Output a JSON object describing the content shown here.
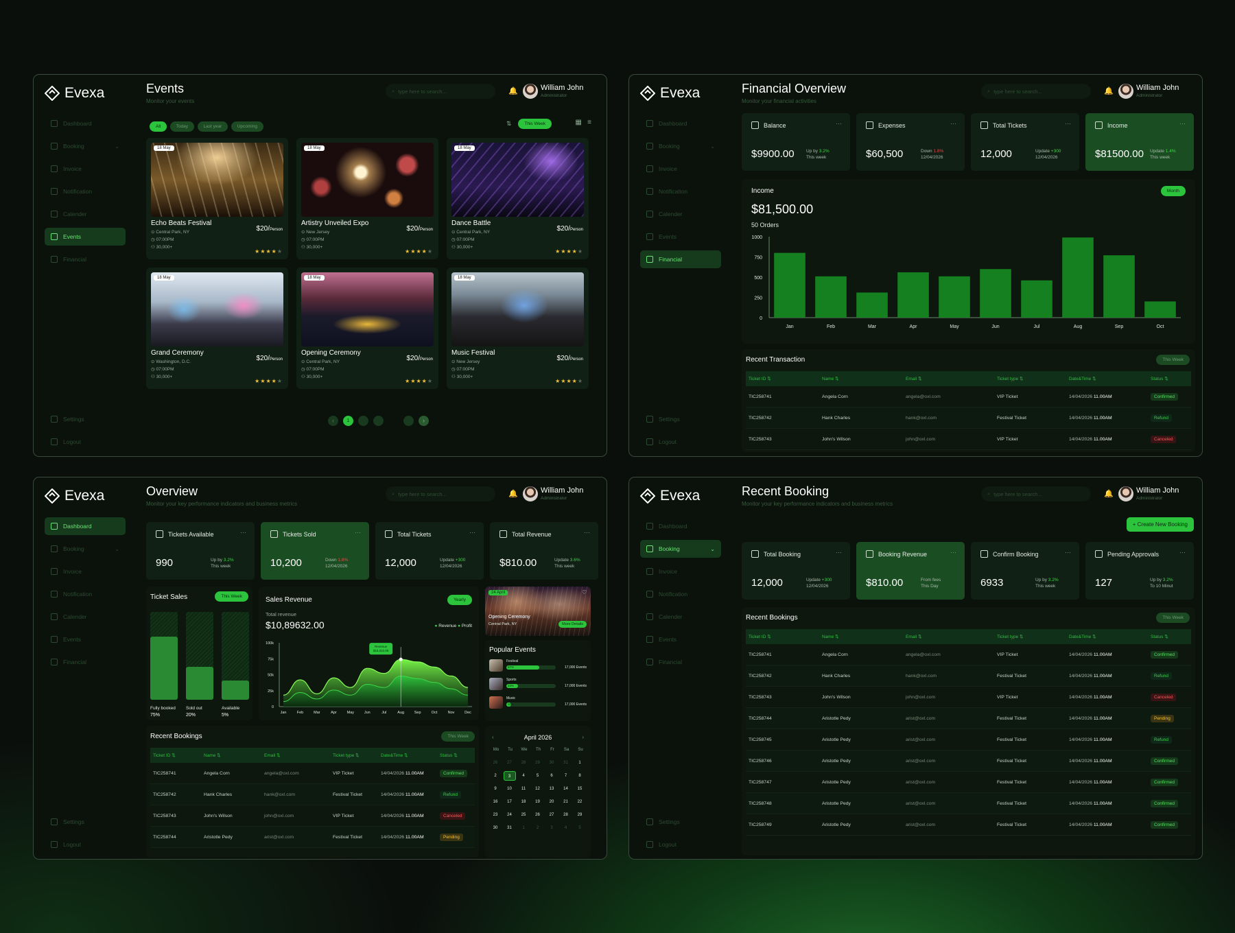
{
  "brand": "Evexa",
  "user": {
    "name": "William John",
    "role": "Administrator"
  },
  "search_placeholder": "type here to search...",
  "nav": {
    "dashboard": "Dashboard",
    "booking": "Booking",
    "invoice": "Invoice",
    "notification": "Notification",
    "calender": "Calender",
    "events": "Events",
    "financial": "Financial",
    "settings": "Settings",
    "logout": "Logout"
  },
  "events_page": {
    "title": "Events",
    "subtitle": "Monitor your events",
    "filters": [
      "All",
      "Today",
      "Last year",
      "Upcoming"
    ],
    "period": "This Week",
    "events": [
      {
        "date": "18 May",
        "name": "Echo Beats Festival",
        "location": "Central Park, NY",
        "time": "07:00PM",
        "count": "30,000+",
        "price": "$20/",
        "unit": "Person",
        "rating": 4
      },
      {
        "date": "18 May",
        "name": "Artistry Unveiled Expo",
        "location": "New Jersey",
        "time": "07:00PM",
        "count": "30,000+",
        "price": "$20/",
        "unit": "Person",
        "rating": 4
      },
      {
        "date": "18 May",
        "name": "Dance Battle",
        "location": "Central Park, NY",
        "time": "07:00PM",
        "count": "30,000+",
        "price": "$20/",
        "unit": "Person",
        "rating": 4
      },
      {
        "date": "18 May",
        "name": "Grand Ceremony",
        "location": "Washington, D.C.",
        "time": "07:00PM",
        "count": "30,000+",
        "price": "$20/",
        "unit": "Person",
        "rating": 4
      },
      {
        "date": "18 May",
        "name": "Opening Ceremony",
        "location": "Central Park, NY",
        "time": "07:00PM",
        "count": "30,000+",
        "price": "$20/",
        "unit": "Person",
        "rating": 4
      },
      {
        "date": "18 May",
        "name": "Music Festival",
        "location": "New Jersey",
        "time": "07:00PM",
        "count": "30,000+",
        "price": "$20/",
        "unit": "Person",
        "rating": 4
      }
    ],
    "pagination": {
      "current": 1,
      "pages": [
        "1",
        "2",
        "3",
        "...",
        "9"
      ]
    }
  },
  "financial_page": {
    "title": "Financial Overview",
    "subtitle": "Monitor your financial activities",
    "stats": [
      {
        "label": "Balance",
        "value": "$9900.00",
        "delta_label": "Up by",
        "delta": "3.2%",
        "note": "This week",
        "trend": "up"
      },
      {
        "label": "Expenses",
        "value": "$60,500",
        "delta_label": "Down",
        "delta": "1.8%",
        "note": "12/04/2026",
        "trend": "down"
      },
      {
        "label": "Total Tickets",
        "value": "12,000",
        "delta_label": "Update",
        "delta": "+300",
        "note": "12/04/2026",
        "trend": "up"
      },
      {
        "label": "Income",
        "value": "$81500.00",
        "delta_label": "Update",
        "delta": "1.4%",
        "note": "This week",
        "trend": "up"
      }
    ],
    "income": {
      "label": "Income",
      "value": "$81,500.00",
      "orders": "50 Orders",
      "period": "Month"
    },
    "recent_title": "Recent Transaction",
    "recent_period": "This Week"
  },
  "table_headers": [
    "Ticket ID",
    "Name",
    "Email",
    "Ticket type",
    "Date&Time",
    "Status"
  ],
  "transactions": [
    {
      "id": "TIC258741",
      "name": "Angela Corn",
      "email": "angela@oxl.com",
      "type": "VIP Ticket",
      "date": "14/04/2026",
      "time": "11.00AM",
      "status": "Confirmed"
    },
    {
      "id": "TIC258742",
      "name": "Hank Charles",
      "email": "hank@oxl.com",
      "type": "Festival Ticket",
      "date": "14/04/2026",
      "time": "11.00AM",
      "status": "Refund"
    },
    {
      "id": "TIC258743",
      "name": "John's Wilson",
      "email": "john@oxl.com",
      "type": "VIP Ticket",
      "date": "14/04/2026",
      "time": "11.00AM",
      "status": "Canceled"
    },
    {
      "id": "TIC258744",
      "name": "Aristotle Pedy",
      "email": "arist@oxl.com",
      "type": "Festival Ticket",
      "date": "14/04/2026",
      "time": "11.00AM",
      "status": "Pending"
    },
    {
      "id": "TIC258745",
      "name": "Aristotle Pedy",
      "email": "arist@oxl.com",
      "type": "Festival Ticket",
      "date": "14/04/2026",
      "time": "11.00AM",
      "status": "Refund"
    },
    {
      "id": "TIC258746",
      "name": "Aristotle Pedy",
      "email": "arist@oxl.com",
      "type": "Festival Ticket",
      "date": "14/04/2026",
      "time": "11.00AM",
      "status": "Confirmed"
    },
    {
      "id": "TIC258747",
      "name": "Aristotle Pedy",
      "email": "arist@oxl.com",
      "type": "Festival Ticket",
      "date": "14/04/2026",
      "time": "11.00AM",
      "status": "Confirmed"
    },
    {
      "id": "TIC258748",
      "name": "Aristotle Pedy",
      "email": "arist@oxl.com",
      "type": "Festival Ticket",
      "date": "14/04/2026",
      "time": "11.00AM",
      "status": "Confirmed"
    },
    {
      "id": "TIC258749",
      "name": "Aristotle Pedy",
      "email": "arist@oxl.com",
      "type": "Festival Ticket",
      "date": "14/04/2026",
      "time": "11.00AM",
      "status": "Confirmed"
    }
  ],
  "overview_page": {
    "title": "Overview",
    "subtitle": "Monitor your key performance indicators and business metrics",
    "stats": [
      {
        "label": "Tickets Available",
        "value": "990",
        "delta_label": "Up by",
        "delta": "3.2%",
        "note": "This week",
        "trend": "up"
      },
      {
        "label": "Tickets Sold",
        "value": "10,200",
        "delta_label": "Down",
        "delta": "1.8%",
        "note": "12/04/2026",
        "trend": "down"
      },
      {
        "label": "Total Tickets",
        "value": "12,000",
        "delta_label": "Update",
        "delta": "+300",
        "note": "12/04/2026",
        "trend": "up"
      },
      {
        "label": "Total Revenue",
        "value": "$810.00",
        "delta_label": "Update",
        "delta": "3.6%",
        "note": "This week",
        "trend": "up"
      }
    ],
    "ticket_sales": {
      "title": "Ticket Sales",
      "period": "This Week",
      "bars": [
        {
          "label": "Fully booked",
          "pct": "75%",
          "value": 75
        },
        {
          "label": "Sold out",
          "pct": "20%",
          "value": 20
        },
        {
          "label": "Available",
          "pct": "5%",
          "value": 5
        }
      ]
    },
    "sales_revenue": {
      "title": "Sales Revenue",
      "period": "Yearly",
      "total_label": "Total revenue",
      "total": "$10,89632.00",
      "legend": [
        "Revenue",
        "Profit"
      ],
      "tooltip_label": "Revenue",
      "tooltip_value": "$15,022.00"
    },
    "feature": {
      "date": "24 April",
      "name": "Opening Ceremony",
      "location": "Central Park, NY",
      "button": "More Details"
    },
    "popular": {
      "title": "Popular Events",
      "items": [
        {
          "name": "Festival",
          "pct": "67%",
          "value": 67,
          "count": "17,000 Events"
        },
        {
          "name": "Sports",
          "pct": "23%",
          "value": 23,
          "count": "17,000 Events"
        },
        {
          "name": "Music",
          "pct": "10%",
          "value": 10,
          "count": "17,000 Events"
        }
      ]
    },
    "bookings_title": "Recent Bookings",
    "bookings_period": "This Week",
    "calendar": {
      "month": "April 2026",
      "weekdays": [
        "Mo",
        "Tu",
        "We",
        "Th",
        "Fr",
        "Sa",
        "Su"
      ],
      "days": [
        [
          "26",
          "27",
          "28",
          "29",
          "30",
          "31",
          "1"
        ],
        [
          "2",
          "3",
          "4",
          "5",
          "6",
          "7",
          "8"
        ],
        [
          "9",
          "10",
          "11",
          "12",
          "13",
          "14",
          "15"
        ],
        [
          "16",
          "17",
          "18",
          "19",
          "20",
          "21",
          "22"
        ],
        [
          "23",
          "24",
          "25",
          "26",
          "27",
          "28",
          "29"
        ],
        [
          "30",
          "31",
          "1",
          "2",
          "3",
          "4",
          "5"
        ]
      ],
      "selected": "3"
    }
  },
  "booking_page": {
    "title": "Recent Booking",
    "subtitle": "Monitor your key performance indicators and business metrics",
    "create_button": "+ Create New Booking",
    "stats": [
      {
        "label": "Total Booking",
        "value": "12,000",
        "delta_label": "Update",
        "delta": "+300",
        "note": "12/04/2026",
        "trend": "up"
      },
      {
        "label": "Booking Revenue",
        "value": "$810.00",
        "delta_label": "From fees",
        "delta": "",
        "note": "This Day",
        "trend": "up"
      },
      {
        "label": "Confirm Booking",
        "value": "6933",
        "delta_label": "Up by",
        "delta": "3.2%",
        "note": "This week",
        "trend": "up"
      },
      {
        "label": "Pending Approvals",
        "value": "127",
        "delta_label": "Up by",
        "delta": "3.2%",
        "note": "To 10 Minut",
        "trend": "up"
      }
    ],
    "list_title": "Recent Bookings",
    "period": "This Week"
  },
  "chart_data": [
    {
      "type": "bar",
      "title": "Income",
      "categories": [
        "Jan",
        "Feb",
        "Mar",
        "Apr",
        "May",
        "Jun",
        "Jul",
        "Aug",
        "Sep",
        "Oct"
      ],
      "values": [
        800,
        510,
        310,
        560,
        510,
        600,
        460,
        990,
        770,
        200
      ],
      "ylim": [
        0,
        1000
      ],
      "yticks": [
        0,
        250,
        500,
        750,
        1000
      ]
    },
    {
      "type": "area",
      "title": "Sales Revenue",
      "categories": [
        "Jan",
        "Feb",
        "Mar",
        "Apr",
        "May",
        "Jun",
        "Jul",
        "Aug",
        "Sep",
        "Oct",
        "Nov",
        "Dec"
      ],
      "series": [
        {
          "name": "Revenue",
          "values": [
            18,
            42,
            20,
            45,
            30,
            60,
            52,
            74,
            70,
            62,
            48,
            30
          ]
        },
        {
          "name": "Profit",
          "values": [
            8,
            22,
            12,
            26,
            18,
            35,
            30,
            48,
            44,
            38,
            28,
            18
          ]
        }
      ],
      "ylim": [
        0,
        100
      ],
      "yticks": [
        "0",
        "25k",
        "50k",
        "75k",
        "100k"
      ]
    }
  ],
  "colors": {
    "accent": "#2bc43c",
    "panel": "#0a120b",
    "card": "#112014"
  }
}
